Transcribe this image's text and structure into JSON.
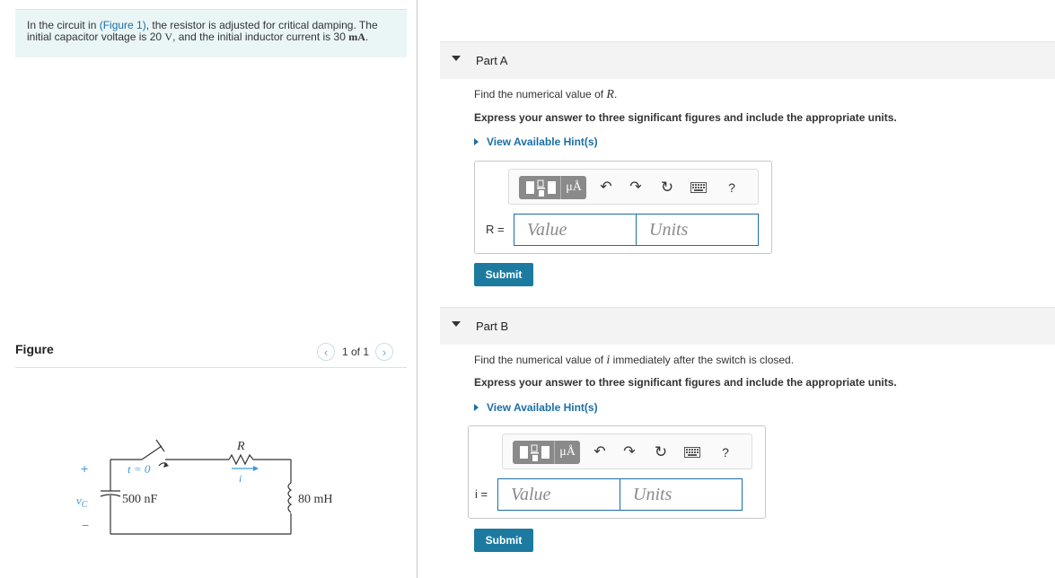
{
  "problem": {
    "text_1": "In the circuit in ",
    "figure_link": "(Figure 1)",
    "text_2": ", the resistor is adjusted for critical damping. The initial capacitor voltage is 20 ",
    "unit_v": "V",
    "text_3": ", and the initial inductor current is 30 ",
    "unit_ma": "mA",
    "text_4": "."
  },
  "figure": {
    "title": "Figure",
    "counter": "1 of 1",
    "labels": {
      "r": "R",
      "t0": "t = 0",
      "i": "i",
      "plus": "+",
      "minus": "−",
      "vc": "v",
      "vc_sub": "C",
      "cap": "500 nF",
      "ind": "80 mH"
    }
  },
  "parts": [
    {
      "label": "Part A",
      "question_pre": "Find the numerical value of ",
      "question_var": "R",
      "question_post": ".",
      "instruction": "Express your answer to three significant figures and include the appropriate units.",
      "hint": "View Available Hint(s)",
      "var_label": "R =",
      "value_placeholder": "Value",
      "units_placeholder": "Units",
      "submit": "Submit"
    },
    {
      "label": "Part B",
      "question_pre": "Find the numerical value of ",
      "question_var": "i",
      "question_post": " immediately after the switch is closed.",
      "instruction": "Express your answer to three significant figures and include the appropriate units.",
      "hint": "View Available Hint(s)",
      "var_label": "i =",
      "value_placeholder": "Value",
      "units_placeholder": "Units",
      "submit": "Submit"
    }
  ],
  "toolbar": {
    "units_button": "μÅ",
    "help": "?"
  }
}
